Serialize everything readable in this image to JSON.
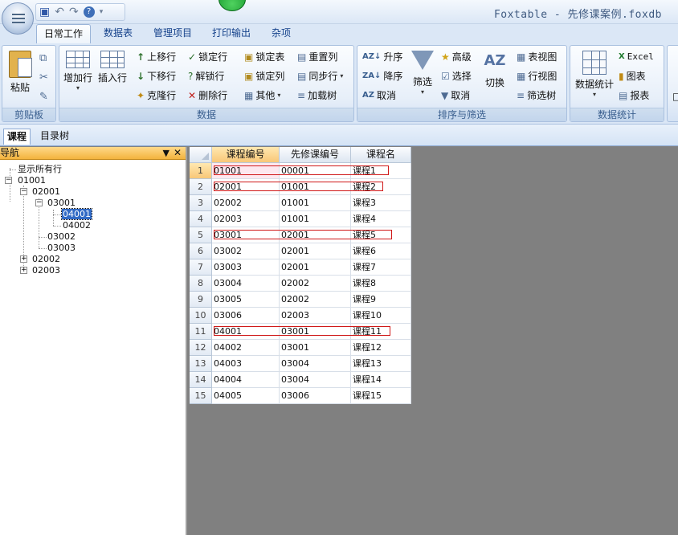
{
  "app": {
    "title": "Foxtable - 先修课案例.foxdb"
  },
  "quick_access": {
    "save_icon": "save-icon",
    "undo_icon": "undo-icon",
    "redo_icon": "redo-icon",
    "help_icon": "help-icon",
    "customize_icon": "chevron-down-icon"
  },
  "tabs": [
    {
      "label": "日常工作",
      "active": true
    },
    {
      "label": "数据表"
    },
    {
      "label": "管理项目"
    },
    {
      "label": "打印输出"
    },
    {
      "label": "杂项"
    }
  ],
  "ribbon": {
    "clipboard": {
      "label": "剪贴板",
      "paste": "粘贴"
    },
    "data": {
      "label": "数据",
      "add_row": "增加行",
      "insert_row": "插入行",
      "move_up": "上移行",
      "move_down": "下移行",
      "clone_row": "克隆行",
      "lock_row": "锁定行",
      "unlock_row": "解锁行",
      "delete_row": "删除行",
      "lock_table": "锁定表",
      "lock_col": "锁定列",
      "other": "其他",
      "reset_col": "重置列",
      "sync_row": "同步行",
      "load_tree": "加载树"
    },
    "sort_filter": {
      "label": "排序与筛选",
      "asc": "升序",
      "desc": "降序",
      "cancel_sort": "取消",
      "filter": "筛选",
      "advanced": "高级",
      "select": "选择",
      "cancel_filter": "取消",
      "switch": "切换"
    },
    "stats": {
      "label": "数据统计",
      "data_stats": "数据统计",
      "table_view": "表视图",
      "row_view": "行视图",
      "filter_tree": "筛选树",
      "excel": "Excel",
      "chart": "图表",
      "report": "报表"
    }
  },
  "doc_tabs": [
    {
      "label": "课程",
      "active": true
    },
    {
      "label": "目录树"
    }
  ],
  "nav": {
    "title": "导航",
    "pin_icon": "pin-icon",
    "close_icon": "close-icon",
    "tree": {
      "show_all": "显示所有行",
      "n01001": "01001",
      "n02001": "02001",
      "n03001": "03001",
      "n04001": "04001",
      "n04002": "04002",
      "n03002": "03002",
      "n03003": "03003",
      "n02002": "02002",
      "n02003": "02003"
    }
  },
  "grid": {
    "columns": [
      "课程编号",
      "先修课编号",
      "课程名"
    ],
    "rows": [
      {
        "num": "1",
        "id": "01001",
        "pre": "00001",
        "name": "课程1",
        "marked": true
      },
      {
        "num": "2",
        "id": "02001",
        "pre": "01001",
        "name": "课程2",
        "marked": true
      },
      {
        "num": "3",
        "id": "02002",
        "pre": "01001",
        "name": "课程3"
      },
      {
        "num": "4",
        "id": "02003",
        "pre": "01001",
        "name": "课程4"
      },
      {
        "num": "5",
        "id": "03001",
        "pre": "02001",
        "name": "课程5",
        "marked": true
      },
      {
        "num": "6",
        "id": "03002",
        "pre": "02001",
        "name": "课程6"
      },
      {
        "num": "7",
        "id": "03003",
        "pre": "02001",
        "name": "课程7"
      },
      {
        "num": "8",
        "id": "03004",
        "pre": "02002",
        "name": "课程8"
      },
      {
        "num": "9",
        "id": "03005",
        "pre": "02002",
        "name": "课程9"
      },
      {
        "num": "10",
        "id": "03006",
        "pre": "02003",
        "name": "课程10"
      },
      {
        "num": "11",
        "id": "04001",
        "pre": "03001",
        "name": "课程11",
        "marked": true
      },
      {
        "num": "12",
        "id": "04002",
        "pre": "03001",
        "name": "课程12"
      },
      {
        "num": "13",
        "id": "04003",
        "pre": "03004",
        "name": "课程13"
      },
      {
        "num": "14",
        "id": "04004",
        "pre": "03004",
        "name": "课程14"
      },
      {
        "num": "15",
        "id": "04005",
        "pre": "03006",
        "name": "课程15"
      }
    ]
  },
  "colors": {
    "accent": "#15428b",
    "nav_header": "#f3b33d",
    "marker": "#d01818",
    "selection": "#316ac5"
  }
}
